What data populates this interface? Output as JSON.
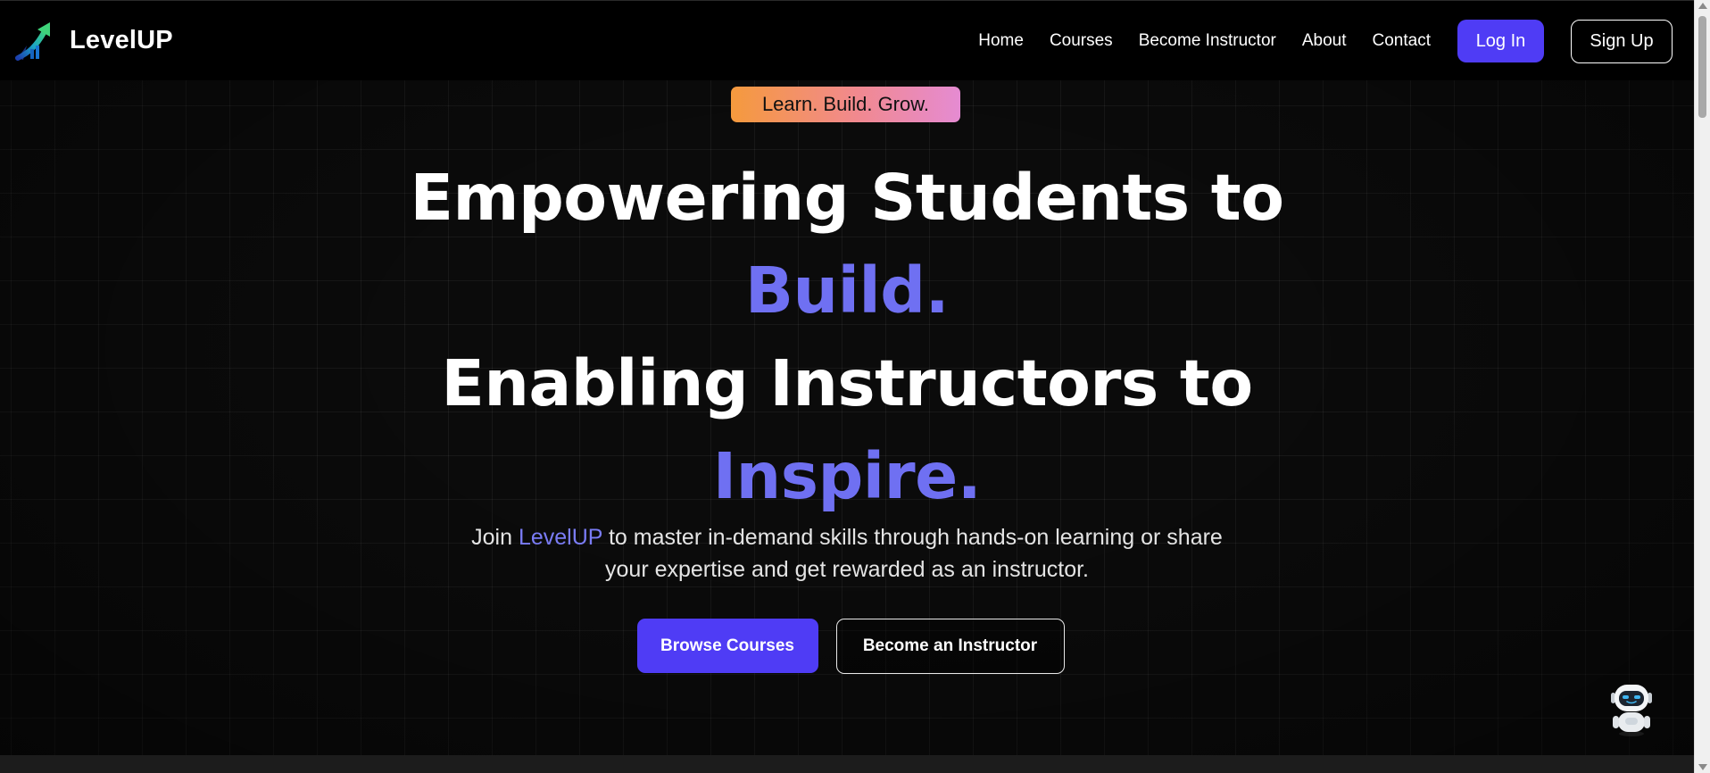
{
  "app": {
    "name": "LevelUP"
  },
  "navbar": {
    "links": [
      {
        "label": "Home"
      },
      {
        "label": "Courses"
      },
      {
        "label": "Become Instructor"
      },
      {
        "label": "About"
      },
      {
        "label": "Contact"
      }
    ],
    "login_label": "Log In",
    "signup_label": "Sign Up"
  },
  "hero": {
    "badge": "Learn. Build. Grow.",
    "headline": {
      "line1": "Empowering Students to",
      "line2": "Build.",
      "line3": "Enabling Instructors to",
      "line4": "Inspire."
    },
    "subtitle": {
      "prefix": "Join ",
      "brand": "LevelUP",
      "line1_rest": " to master in-demand skills through hands-on learning or share",
      "line2": "your expertise and get rewarded as an instructor."
    },
    "primary_cta": "Browse Courses",
    "secondary_cta": "Become an Instructor"
  },
  "icons": {
    "logo": "growth-arrow-icon",
    "assistant": "robot-assistant-icon"
  },
  "colors": {
    "accent": "#4f3cf5",
    "headline_accent": "#6f70f2",
    "background": "#0b0b0b",
    "badge_gradient_start": "#f59a3d",
    "badge_gradient_end": "#e58bd2"
  }
}
